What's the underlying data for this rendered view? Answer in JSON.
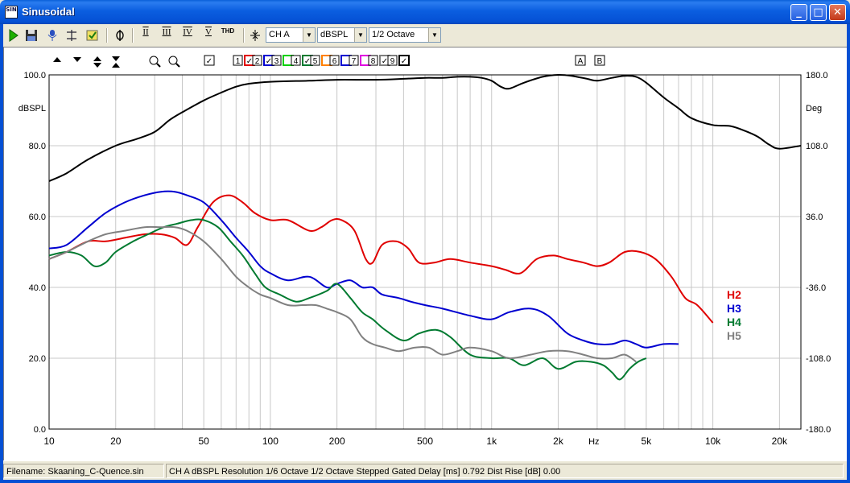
{
  "window": {
    "title": "Sinusoidal",
    "icon_label": "SIN"
  },
  "title_buttons": {
    "minimize": "_",
    "maximize": "□",
    "close": "✕"
  },
  "toolbar": {
    "run_icon": "play-icon",
    "save_icon": "floppy-icon",
    "thd_label": "THD",
    "roman": [
      "II",
      "III",
      "IV",
      "V"
    ],
    "channel": {
      "value": "CH A",
      "arrow": "▼"
    },
    "unit": {
      "value": "dBSPL",
      "arrow": "▼"
    },
    "smoothing": {
      "value": "1/2 Octave",
      "arrow": "▼"
    }
  },
  "plot_toolbar": {
    "channels": [
      "1",
      "2",
      "3",
      "4",
      "5",
      "6",
      "7",
      "8",
      "9"
    ],
    "channel_colors": [
      "#e00000",
      "#0000d0",
      "#00d000",
      "#007a30",
      "#ff8000",
      "#0000d0",
      "#e000e0",
      "#808080",
      "#000000"
    ],
    "channel_checked": [
      true,
      true,
      false,
      true,
      false,
      false,
      false,
      true,
      true
    ],
    "a_label": "A",
    "b_label": "B",
    "check_mark": "✓"
  },
  "chart_data": {
    "type": "line",
    "x_scale": "log",
    "xlim": [
      10,
      25000
    ],
    "xticks": [
      {
        "v": 10,
        "label": "10"
      },
      {
        "v": 20,
        "label": "20"
      },
      {
        "v": 50,
        "label": "50"
      },
      {
        "v": 100,
        "label": "100"
      },
      {
        "v": 200,
        "label": "200"
      },
      {
        "v": 500,
        "label": "500"
      },
      {
        "v": 1000,
        "label": "1k"
      },
      {
        "v": 2000,
        "label": "2k"
      },
      {
        "v": 5000,
        "label": "5k"
      },
      {
        "v": 10000,
        "label": "10k"
      },
      {
        "v": 20000,
        "label": "20k"
      }
    ],
    "xunit_label": "Hz",
    "xunit_at": 2900,
    "ylim": [
      0,
      100
    ],
    "yticks": [
      "0.0",
      "20.0",
      "40.0",
      "60.0",
      "80.0",
      "100.0"
    ],
    "ylabel": "dBSPL",
    "y2lim": [
      -180,
      180
    ],
    "y2ticks": [
      "-180.0",
      "-108.0",
      "-36.0",
      "36.0",
      "108.0",
      "180.0"
    ],
    "y2label": "Deg",
    "series": [
      {
        "name": "",
        "color": "#000000",
        "axis": "right",
        "x": [
          10,
          12,
          15,
          20,
          25,
          30,
          35,
          40,
          50,
          60,
          70,
          80,
          100,
          150,
          200,
          300,
          400,
          500,
          600,
          700,
          800,
          900,
          1000,
          1100,
          1200,
          1400,
          1700,
          2000,
          2300,
          2700,
          3000,
          3500,
          4000,
          4500,
          5000,
          6000,
          7000,
          8000,
          10000,
          12000,
          14000,
          16000,
          18000,
          20000,
          25000
        ],
        "y": [
          72,
          80,
          94,
          108,
          115,
          122,
          134,
          142,
          154,
          162,
          168,
          171,
          173,
          174,
          175,
          175,
          176,
          177,
          177,
          178,
          178,
          177,
          174,
          168,
          166,
          172,
          178,
          180,
          179,
          176,
          174,
          177,
          179,
          178,
          172,
          157,
          146,
          136,
          129,
          128,
          123,
          117,
          109,
          105,
          108
        ]
      },
      {
        "name": "H2",
        "color": "#e00000",
        "axis": "left",
        "x": [
          10,
          12,
          15,
          18,
          22,
          27,
          32,
          37,
          42,
          47,
          55,
          65,
          75,
          85,
          100,
          120,
          150,
          170,
          190,
          210,
          240,
          270,
          290,
          320,
          370,
          420,
          470,
          550,
          650,
          800,
          1000,
          1150,
          1350,
          1600,
          1900,
          2200,
          2600,
          3000,
          3400,
          4000,
          4700,
          5500,
          6500,
          7500,
          8500,
          10000
        ],
        "y": [
          48,
          50,
          53,
          53,
          54,
          55,
          55,
          54,
          52,
          57,
          64,
          66,
          64,
          61,
          59,
          59,
          56,
          57,
          59,
          59,
          56,
          48,
          47,
          52,
          53,
          51,
          47,
          47,
          48,
          47,
          46,
          45,
          44,
          48,
          49,
          48,
          47,
          46,
          47,
          50,
          50,
          48,
          43,
          37,
          35,
          30
        ]
      },
      {
        "name": "H3",
        "color": "#0000d0",
        "axis": "left",
        "x": [
          10,
          12,
          15,
          18,
          22,
          27,
          32,
          37,
          42,
          50,
          60,
          70,
          80,
          90,
          100,
          120,
          150,
          180,
          200,
          230,
          260,
          290,
          320,
          380,
          430,
          500,
          600,
          800,
          1000,
          1200,
          1500,
          1800,
          2200,
          2600,
          3000,
          3500,
          4000,
          4500,
          5000,
          6000,
          7000
        ],
        "y": [
          51,
          52,
          57,
          61,
          64,
          66,
          67,
          67,
          66,
          64,
          59,
          54,
          50,
          46,
          44,
          42,
          43,
          40,
          41,
          42,
          40,
          40,
          38,
          37,
          36,
          35,
          34,
          32,
          31,
          33,
          34,
          32,
          27,
          25,
          24,
          24,
          25,
          24,
          23,
          24,
          24
        ]
      },
      {
        "name": "H4",
        "color": "#007a30",
        "axis": "left",
        "x": [
          10,
          12,
          14,
          16,
          18,
          20,
          24,
          28,
          33,
          38,
          44,
          50,
          58,
          66,
          75,
          85,
          95,
          110,
          130,
          150,
          180,
          200,
          230,
          260,
          290,
          330,
          400,
          470,
          560,
          650,
          800,
          1000,
          1200,
          1400,
          1700,
          2000,
          2400,
          2800,
          3200,
          3500,
          3800,
          4200,
          4600,
          5000
        ],
        "y": [
          49,
          50,
          49,
          46,
          47,
          50,
          53,
          55,
          57,
          58,
          59,
          59,
          57,
          53,
          49,
          44,
          40,
          38,
          36,
          37,
          39,
          41,
          37,
          33,
          31,
          28,
          25,
          27,
          28,
          26,
          21,
          20,
          20,
          18,
          20,
          17,
          19,
          19,
          18,
          16,
          14,
          17,
          19,
          20
        ]
      },
      {
        "name": "H5",
        "color": "#808080",
        "axis": "left",
        "x": [
          10,
          12,
          15,
          18,
          22,
          27,
          32,
          37,
          42,
          50,
          60,
          70,
          80,
          90,
          100,
          120,
          140,
          160,
          180,
          200,
          230,
          260,
          290,
          330,
          380,
          450,
          520,
          600,
          700,
          800,
          1000,
          1200,
          1500,
          1800,
          2200,
          2600,
          3000,
          3500,
          4000,
          4500
        ],
        "y": [
          48,
          50,
          53,
          55,
          56,
          57,
          57,
          57,
          56,
          53,
          48,
          43,
          40,
          38,
          37,
          35,
          35,
          35,
          34,
          33,
          31,
          26,
          24,
          23,
          22,
          23,
          23,
          21,
          22,
          23,
          22,
          20,
          21,
          22,
          22,
          21,
          20,
          20,
          21,
          19
        ]
      }
    ]
  },
  "statusbar": {
    "filename": "Filename: Skaaning_C-Quence.sin",
    "info": "CH A   dBSPL   Resolution 1/6 Octave   1/2 Octave   Stepped   Gated   Delay [ms] 0.792   Dist Rise [dB] 0.00"
  }
}
